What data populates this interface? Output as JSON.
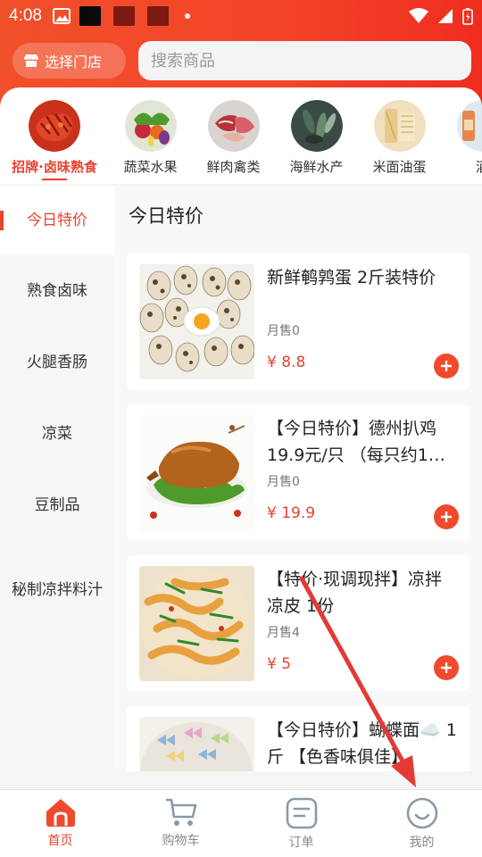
{
  "status_bar": {
    "time": "4:08"
  },
  "header": {
    "store_button_label": "选择门店",
    "search_placeholder": "搜索商品"
  },
  "categories": [
    {
      "label": "招牌·卤味熟食",
      "active": true
    },
    {
      "label": "蔬菜水果"
    },
    {
      "label": "鲜肉禽类"
    },
    {
      "label": "海鲜水产"
    },
    {
      "label": "米面油蛋"
    },
    {
      "label": "酒"
    }
  ],
  "sidebar": {
    "items": [
      {
        "label": "今日特价",
        "active": true
      },
      {
        "label": "熟食卤味"
      },
      {
        "label": "火腿香肠"
      },
      {
        "label": "凉菜"
      },
      {
        "label": "豆制品"
      },
      {
        "label": "秘制凉拌料汁"
      }
    ]
  },
  "content": {
    "section_title": "今日特价",
    "products": [
      {
        "name": "新鲜鹌鹑蛋 2斤装特价",
        "sales": "月售0",
        "price": "¥ 8.8"
      },
      {
        "name": "【今日特价】德州扒鸡 19.9元/只 （每只约1…",
        "sales": "月售0",
        "price": "¥ 19.9"
      },
      {
        "name": "【特价·现调现拌】凉拌凉皮 1份",
        "sales": "月售4",
        "price": "¥ 5"
      },
      {
        "name": "【今日特价】蝴蝶面☁️ 1斤 【色香味俱佳】",
        "sales": "",
        "price": ""
      }
    ]
  },
  "tabbar": {
    "items": [
      {
        "label": "首页",
        "icon": "home-icon",
        "active": true
      },
      {
        "label": "购物车",
        "icon": "cart-icon"
      },
      {
        "label": "订单",
        "icon": "order-icon"
      },
      {
        "label": "我的",
        "icon": "profile-icon"
      }
    ]
  },
  "colors": {
    "accent": "#e64330",
    "header": "#f0502a",
    "add_button": "#f04a2c"
  }
}
